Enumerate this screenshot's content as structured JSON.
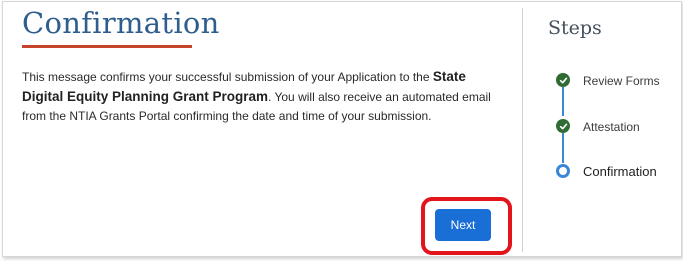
{
  "page": {
    "title": "Confirmation"
  },
  "message": {
    "part1": "This message confirms your successful submission of your Application to the ",
    "program_name": "State Digital Equity Planning Grant Program",
    "part2": ". You will also receive an automated email from the NTIA Grants Portal confirming the date and time of your submission."
  },
  "actions": {
    "next_label": "Next"
  },
  "steps": {
    "heading": "Steps",
    "items": [
      {
        "label": "Review Forms",
        "status": "complete",
        "icon": "check-icon"
      },
      {
        "label": "Attestation",
        "status": "complete",
        "icon": "check-icon"
      },
      {
        "label": "Confirmation",
        "status": "current",
        "icon": "current-step-ring-icon"
      }
    ]
  },
  "colors": {
    "title": "#2e5d8e",
    "title_underline": "#c6442b",
    "primary_button": "#1a6fd6",
    "highlight": "#e3141c",
    "step_complete": "#2f6b33",
    "step_current": "#3a86d8"
  }
}
